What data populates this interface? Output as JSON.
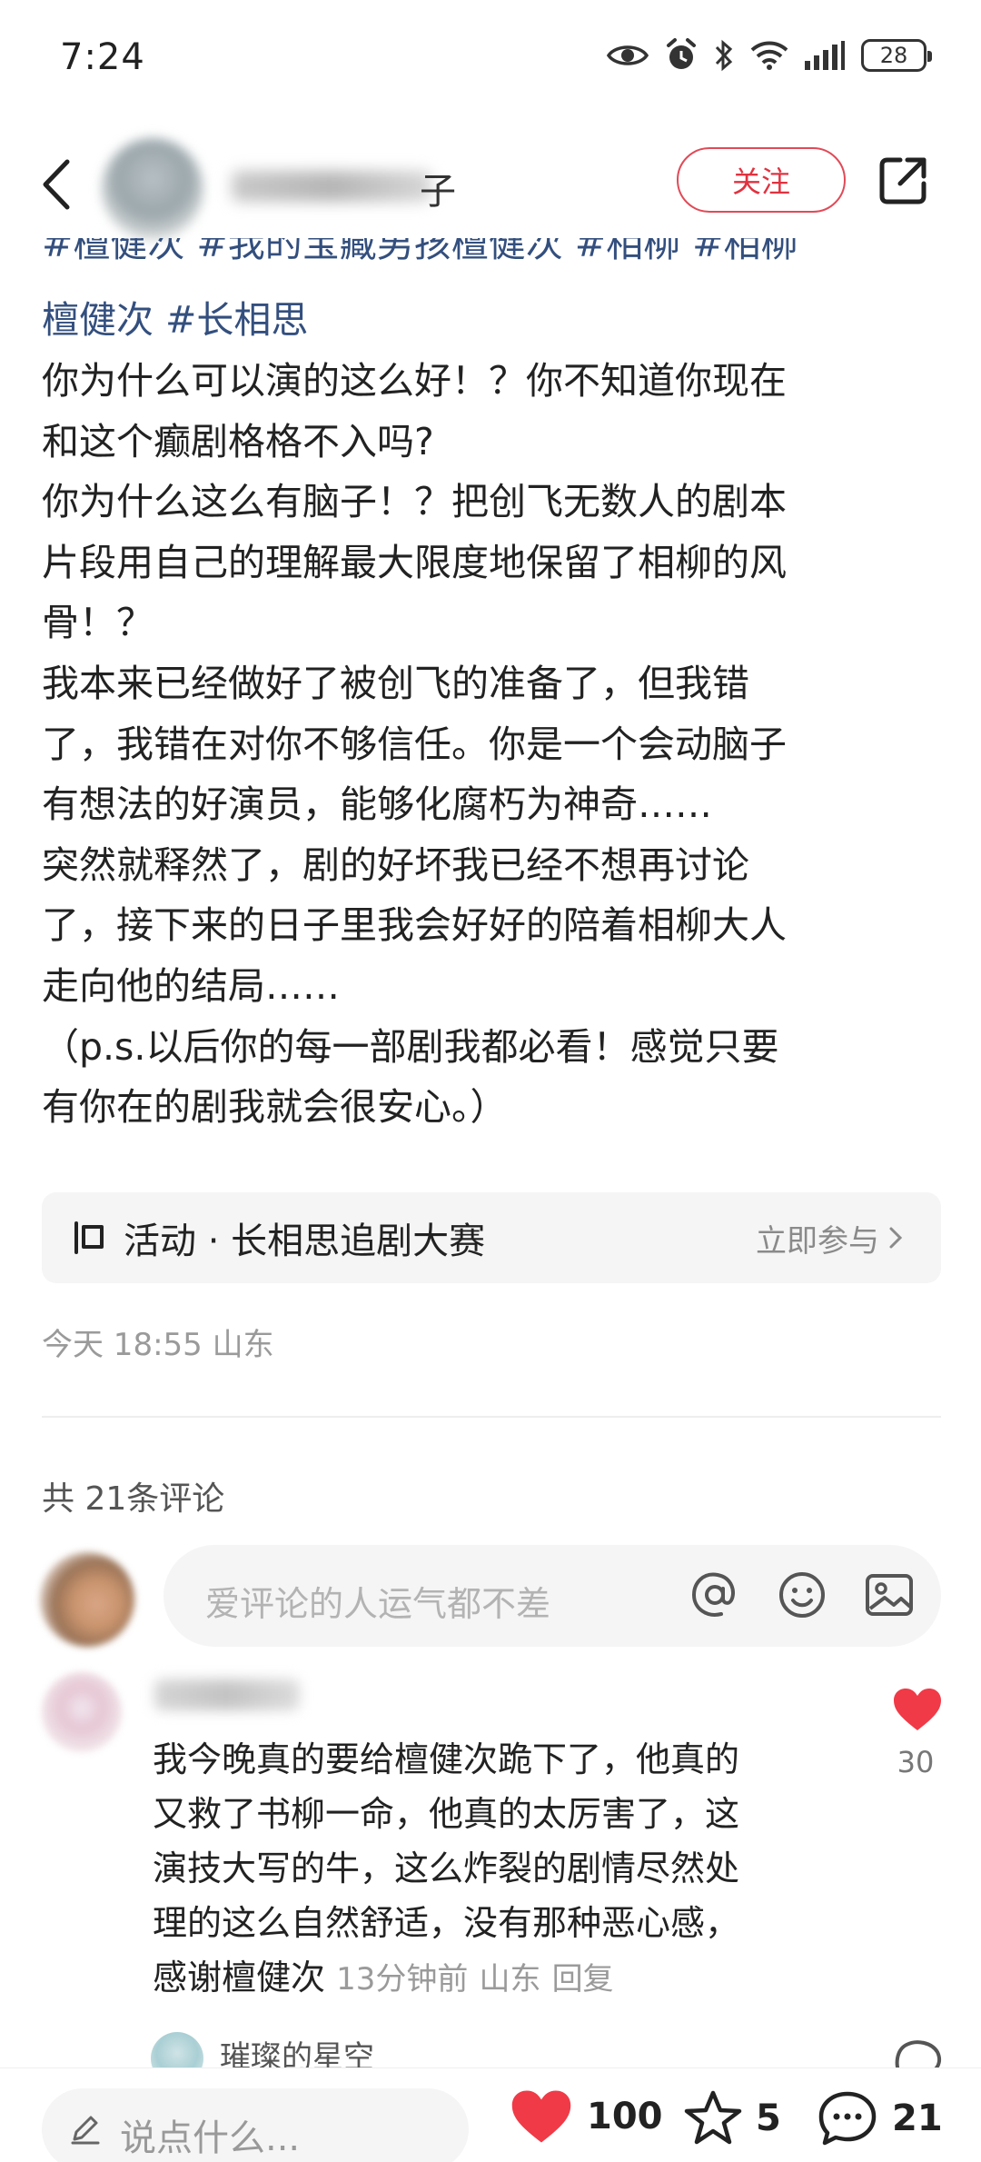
{
  "status_bar": {
    "time": "7:24",
    "battery": "28"
  },
  "header": {
    "name_visible": "子",
    "follow_label": "关注"
  },
  "post": {
    "tags_partial": "#檀健次 #我的宝藏男孩檀健次 #相柳 #相柳",
    "tags": "檀健次 #长相思",
    "lines": [
      "你为什么可以演的这么好！？你不知道你现在",
      "和这个癫剧格格不入吗?",
      "你为什么这么有脑子！？把创飞无数人的剧本",
      "片段用自己的理解最大限度地保留了相柳的风",
      "骨！？",
      "我本来已经做好了被创飞的准备了，但我错",
      "了，我错在对你不够信任。你是一个会动脑子",
      "有想法的好演员，能够化腐朽为神奇……",
      "突然就释然了，剧的好坏我已经不想再讨论",
      "了，接下来的日子里我会好好的陪着相柳大人",
      "走向他的结局……",
      "（p.s.以后你的每一部剧我都必看！感觉只要",
      "有你在的剧我就会很安心。）"
    ]
  },
  "activity": {
    "title": "活动 · 长相思追剧大赛",
    "cta": "立即参与"
  },
  "meta": "今天 18:55 山东",
  "comments_section": {
    "count_label": "共 21条评论",
    "input_placeholder": "爱评论的人运气都不差"
  },
  "comment": {
    "lines": [
      "我今晚真的要给檀健次跪下了，他真的",
      "又救了书柳一命，他真的太厉害了，这",
      "演技大写的牛，这么炸裂的剧情尽然处",
      "理的这么自然舒适，没有那种恶心感，"
    ],
    "last_line": "感谢檀健次",
    "time": "13分钟前",
    "location": "山东",
    "reply_label": "回复",
    "like_count": "30",
    "sub_reply_name": "璀璨的星空"
  },
  "bottom_bar": {
    "say_placeholder": "说点什么...",
    "likes": "100",
    "stars": "5",
    "comments": "21"
  },
  "colors": {
    "accent_red": "#e0323f",
    "tag_blue": "#334f7e"
  }
}
